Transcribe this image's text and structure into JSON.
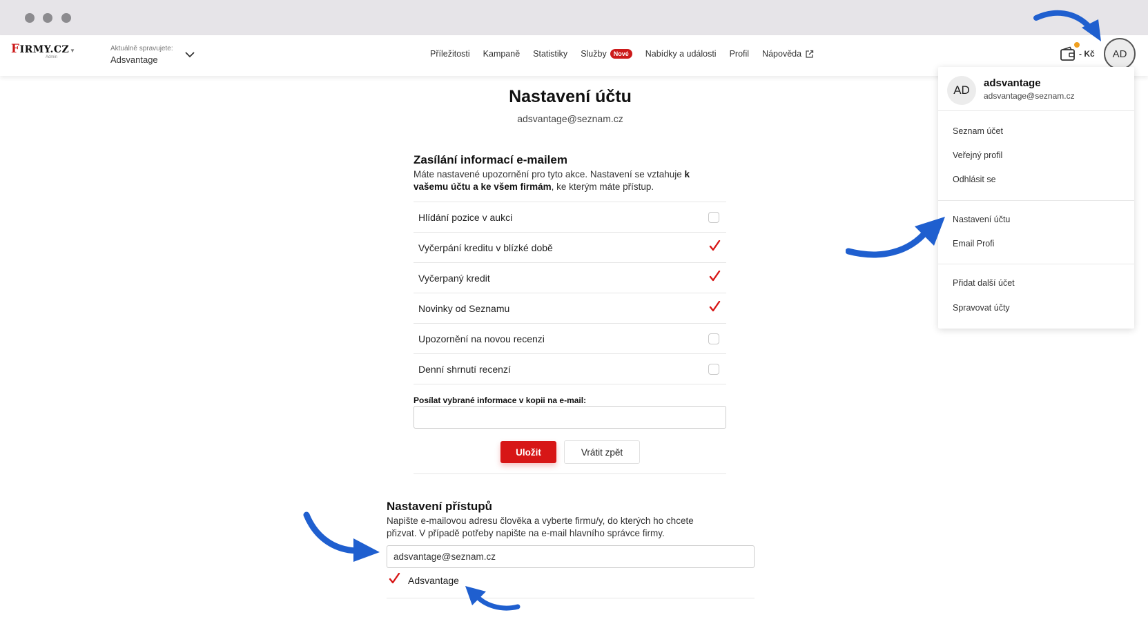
{
  "header": {
    "logo": "FIRMY.CZ",
    "logo_sub": "Admin",
    "account_label": "Aktuálně spravujete:",
    "account_name": "Adsvantage",
    "nav": [
      {
        "label": "Příležitosti"
      },
      {
        "label": "Kampaně"
      },
      {
        "label": "Statistiky"
      },
      {
        "label": "Služby",
        "badge": "Nové"
      },
      {
        "label": "Nabídky a události"
      },
      {
        "label": "Profil"
      },
      {
        "label": "Nápověda"
      }
    ],
    "credit": "- Kč",
    "avatar_initials": "AD"
  },
  "main": {
    "title": "Nastavení účtu",
    "email": "adsvantage@seznam.cz",
    "notifications": {
      "title": "Zasílání informací e-mailem",
      "desc_part1": "Máte nastavené upozornění pro tyto akce. Nastavení se vztahuje ",
      "desc_bold1": "k",
      "desc_line2_bold": "vašemu účtu a ke všem firmám",
      "desc_line2_rest": ", ke kterým máte přístup.",
      "items": [
        {
          "label": "Hlídání pozice v aukci",
          "checked": false
        },
        {
          "label": "Vyčerpání kreditu v blízké době",
          "checked": true
        },
        {
          "label": "Vyčerpaný kredit",
          "checked": true
        },
        {
          "label": "Novinky od Seznamu",
          "checked": true
        },
        {
          "label": "Upozornění na novou recenzi",
          "checked": false
        },
        {
          "label": "Denní shrnutí recenzí",
          "checked": false
        }
      ],
      "cc_label": "Posílat vybrané informace v kopii na e-mail:",
      "cc_value": "",
      "save_label": "Uložit",
      "revert_label": "Vrátit zpět"
    },
    "access": {
      "title": "Nastavení přístupů",
      "desc_line1": "Napište e-mailovou adresu člověka a vyberte firmu/y, do kterých ho chcete",
      "desc_line2": "přizvat. V případě potřeby napište na e-mail hlavního správce firmy.",
      "email_value": "adsvantage@seznam.cz",
      "company": {
        "label": "Adsvantage",
        "checked": true
      }
    }
  },
  "dropdown": {
    "avatar_initials": "AD",
    "name": "adsvantage",
    "email": "adsvantage@seznam.cz",
    "group1": [
      "Seznam účet",
      "Veřejný profil",
      "Odhlásit se"
    ],
    "group2": [
      "Nastavení účtu",
      "Email Profi"
    ],
    "group3": [
      "Přidat další účet",
      "Spravovat účty"
    ]
  },
  "colors": {
    "accent": "#d71616",
    "annotation_arrow": "#1f5fcf"
  }
}
